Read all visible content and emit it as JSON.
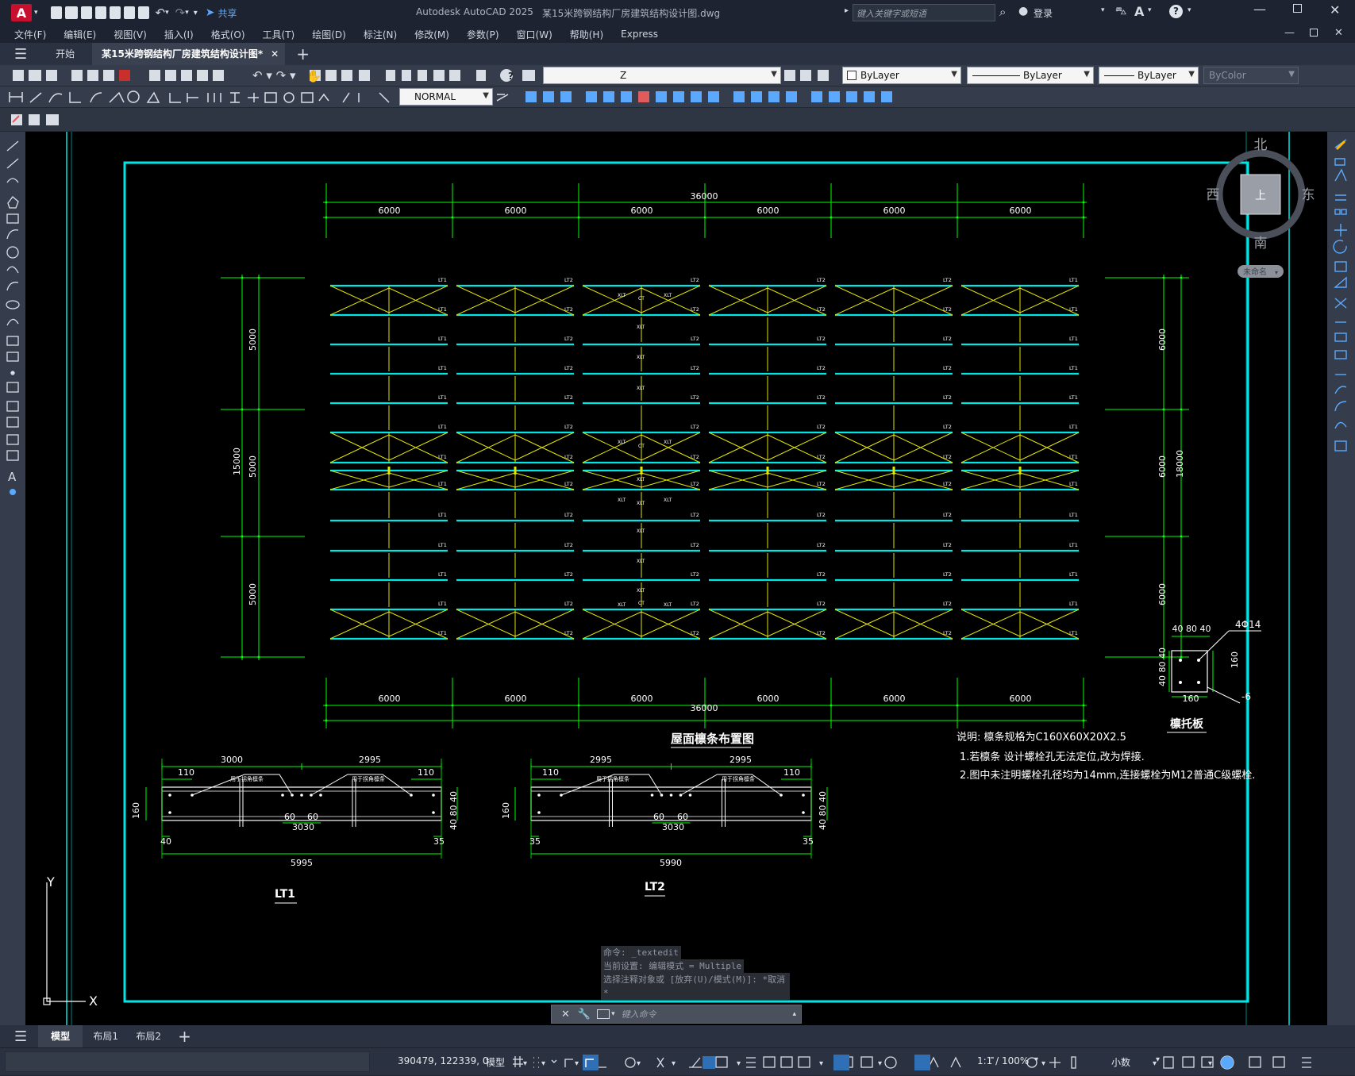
{
  "app": {
    "logo_letter": "A",
    "share_label": "共享",
    "title": "Autodesk AutoCAD 2025",
    "file": "某15米跨钢结构厂房建筑结构设计图.dwg",
    "search_placeholder": "键入关键字或短语",
    "login_label": "登录"
  },
  "menu": [
    "文件(F)",
    "编辑(E)",
    "视图(V)",
    "插入(I)",
    "格式(O)",
    "工具(T)",
    "绘图(D)",
    "标注(N)",
    "修改(M)",
    "参数(P)",
    "窗口(W)",
    "帮助(H)",
    "Express"
  ],
  "doc_tabs": {
    "start": "开始",
    "active": "某15米跨钢结构厂房建筑结构设计图*"
  },
  "toolbar": {
    "layer": "Z",
    "color": "ByLayer",
    "linetype": "ByLayer",
    "lineweight": "ByLayer",
    "plotstyle": "ByColor",
    "textstyle": "NORMAL"
  },
  "viewcube": {
    "north": "北",
    "south": "南",
    "east": "东",
    "west": "西",
    "top": "上",
    "wcs": "未命名"
  },
  "drawing": {
    "top_total": "36000",
    "bottom_total": "36000",
    "bay": "6000",
    "left_total": "15000",
    "left_span": "5000",
    "right_total": "18000",
    "right_span": "6000",
    "plan_title": "屋面檩条布置图",
    "lt1": "LT1",
    "lt2": "LT2",
    "lt2_small": "LT2",
    "ct": "CT",
    "xlt": "XLT",
    "notes_line1": "说明:   檩条规格为C160X60X20X2.5",
    "notes_line2": "1.若檩条 设计螺栓孔无法定位,改为焊接.",
    "notes_line3": "2.图中未注明螺栓孔径均为14mm,连接螺栓为M12普通C级螺栓.",
    "plate_title": "檩托板",
    "plate_top": "40 80 40",
    "plate_left": "40  80  40",
    "plate_right": "160",
    "plate_bottom": "160",
    "plate_bolt": "4Φ14",
    "plate_thk": "-6",
    "d1_top_a": "3000",
    "d1_top_b": "2995",
    "d1_edge": "110",
    "d1_mid": "60",
    "d1_center": "3030",
    "d1_left_end": "40",
    "d1_right_end": "35",
    "d1_total": "5995",
    "d1_depth": "160",
    "d1_side": "40 80 40",
    "d1_note": "用于拐角檩条",
    "d1_name": "LT1",
    "d2_top_a": "2995",
    "d2_top_b": "2995",
    "d2_center": "3030",
    "d2_left_end": "35",
    "d2_right_end": "35",
    "d2_total": "5990",
    "d2_name": "LT2",
    "ucs_x": "X",
    "ucs_y": "Y"
  },
  "command": {
    "history1": "命令: _textedit",
    "history2": "当前设置: 编辑模式 = Multiple",
    "history3": "选择注释对象或 [放弃(U)/模式(M)]: *取消*",
    "placeholder": "键入命令"
  },
  "layout_tabs": [
    "模型",
    "布局1",
    "布局2"
  ],
  "status": {
    "coords": "390479, 122339, 0",
    "model": "模型",
    "scale": "1:1 / 100%",
    "units": "小数"
  },
  "colors": {
    "cyan": "#00e5e5",
    "green": "#00ff00",
    "yellow": "#e5e500",
    "white": "#ffffff"
  }
}
